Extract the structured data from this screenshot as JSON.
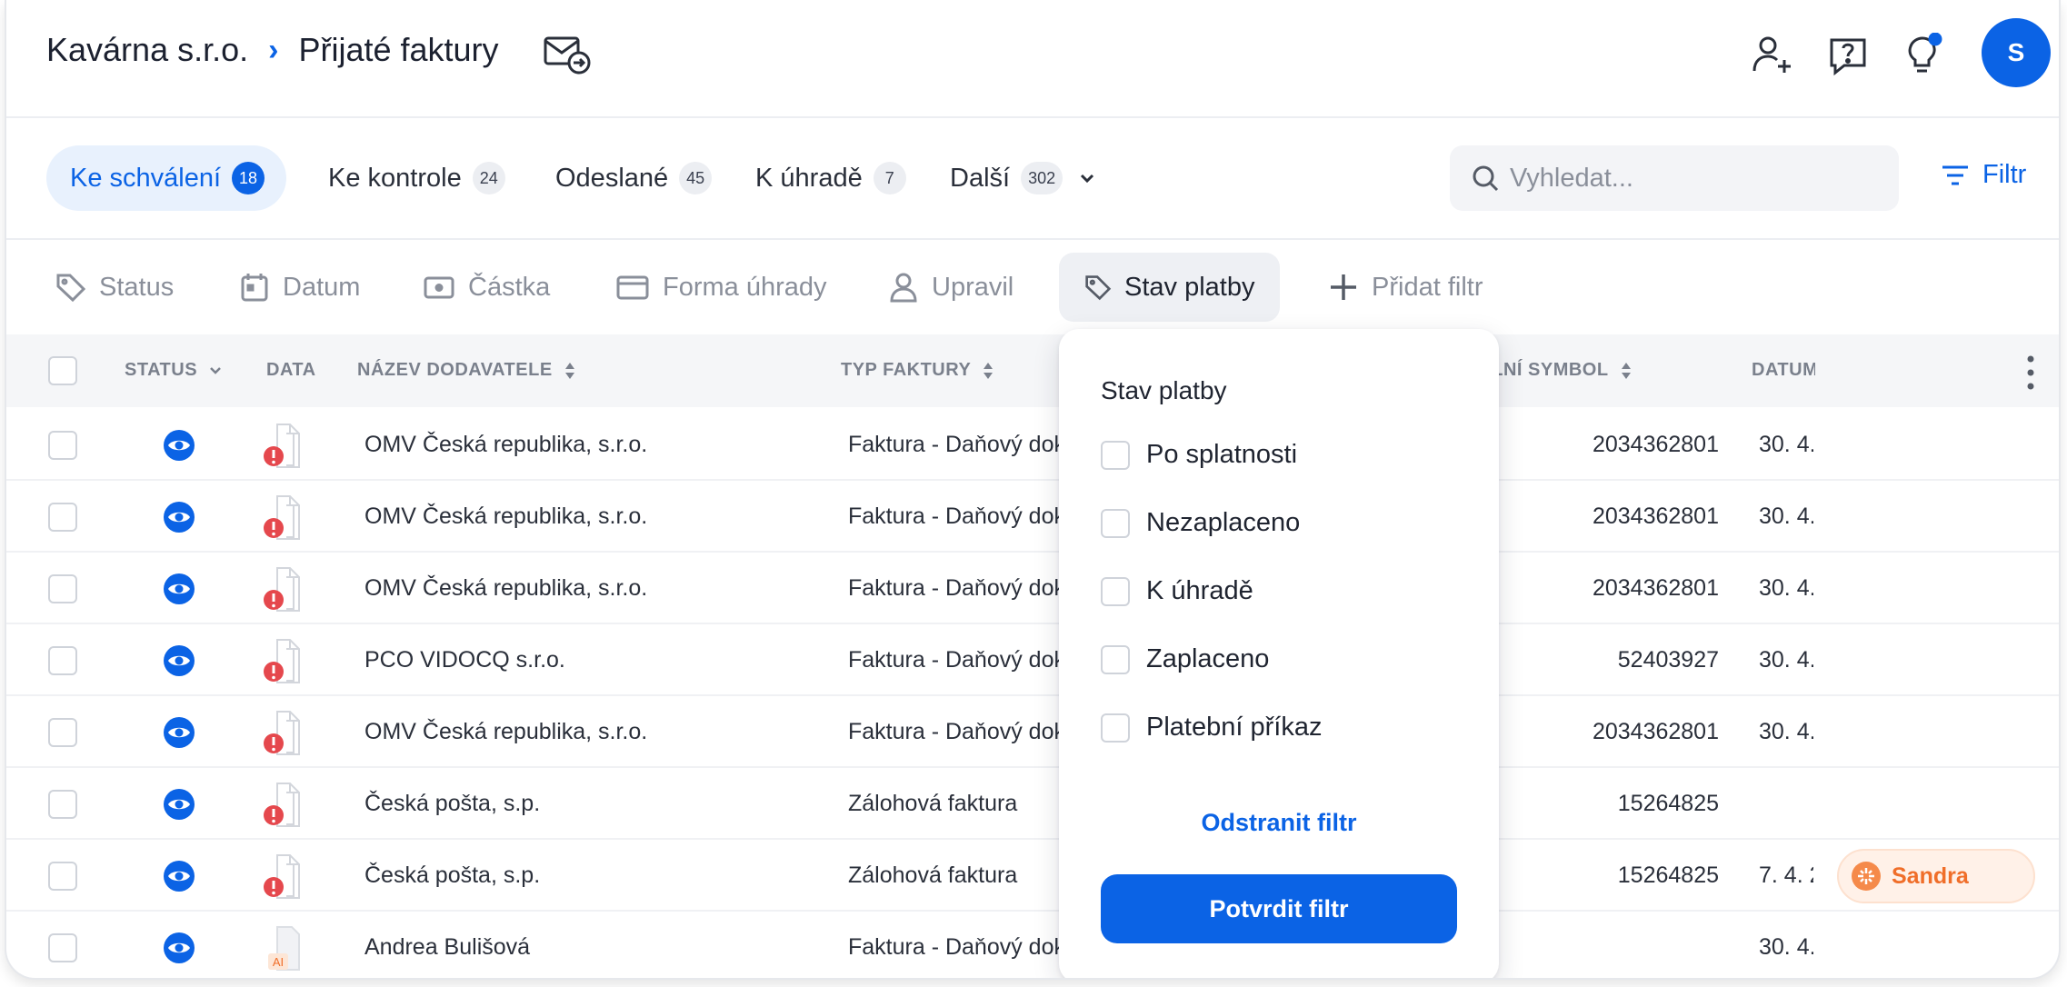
{
  "header": {
    "company": "Kavárna s.r.o.",
    "separator": "›",
    "page_title": "Přijaté faktury",
    "avatar_initial": "S"
  },
  "tabs": [
    {
      "label": "Ke schválení",
      "count": "18",
      "active": true
    },
    {
      "label": "Ke kontrole",
      "count": "24"
    },
    {
      "label": "Odeslané",
      "count": "45"
    },
    {
      "label": "K úhradě",
      "count": "7"
    },
    {
      "label": "Další",
      "count": "302"
    }
  ],
  "search": {
    "placeholder": "Vyhledat..."
  },
  "filter_button": "Filtr",
  "chips": [
    {
      "label": "Status",
      "icon": "tag-icon"
    },
    {
      "label": "Datum",
      "icon": "calendar-icon"
    },
    {
      "label": "Částka",
      "icon": "amount-icon"
    },
    {
      "label": "Forma úhrady",
      "icon": "card-icon"
    },
    {
      "label": "Upravil",
      "icon": "user-icon"
    },
    {
      "label": "Stav platby",
      "icon": "tag-icon",
      "active": true
    },
    {
      "label": "Přidat filtr",
      "icon": "plus-icon"
    }
  ],
  "columns": {
    "status": "STATUS",
    "data": "DATA",
    "supplier": "NÁZEV DODAVATELE",
    "type": "TYP FAKTURY",
    "variable_symbol": "VARIABILNÍ SYMBOL",
    "date": "DATUM"
  },
  "rows": [
    {
      "supplier": "OMV Česká republika, s.r.o.",
      "type": "Faktura - Daňový doklad",
      "vs": "2034362801",
      "date": "30. 4.",
      "doc": "error"
    },
    {
      "supplier": "OMV Česká republika, s.r.o.",
      "type": "Faktura - Daňový doklad",
      "vs": "2034362801",
      "date": "30. 4.",
      "doc": "error"
    },
    {
      "supplier": "OMV Česká republika, s.r.o.",
      "type": "Faktura - Daňový doklad",
      "vs": "2034362801",
      "date": "30. 4.",
      "doc": "error"
    },
    {
      "supplier": "PCO VIDOCQ s.r.o.",
      "type": "Faktura - Daňový doklad",
      "vs": "52403927",
      "date": "30. 4.",
      "doc": "error"
    },
    {
      "supplier": "OMV Česká republika, s.r.o.",
      "type": "Faktura - Daňový doklad",
      "vs": "2034362801",
      "date": "30. 4.",
      "doc": "error"
    },
    {
      "supplier": "Česká pošta, s.p.",
      "type": "Zálohová faktura",
      "vs": "15264825",
      "date": "",
      "doc": "error"
    },
    {
      "supplier": "Česká pošta, s.p.",
      "type": "Zálohová faktura",
      "vs": "15264825",
      "date": "7. 4. 2",
      "doc": "error",
      "tag": "Sandra"
    },
    {
      "supplier": "Andrea Bulišová",
      "type": "Faktura - Daňový doklad",
      "vs": "",
      "date": "30. 4.",
      "doc": "ai",
      "doc_label": "AI"
    }
  ],
  "dropdown": {
    "title": "Stav platby",
    "options": [
      "Po splatnosti",
      "Nezaplaceno",
      "K úhradě",
      "Zaplaceno",
      "Platební příkaz"
    ],
    "remove_label": "Odstranit filtr",
    "confirm_label": "Potvrdit filtr"
  },
  "colors": {
    "accent": "#0b63e5",
    "error": "#e5484d",
    "tag_orange": "#f06e29"
  }
}
